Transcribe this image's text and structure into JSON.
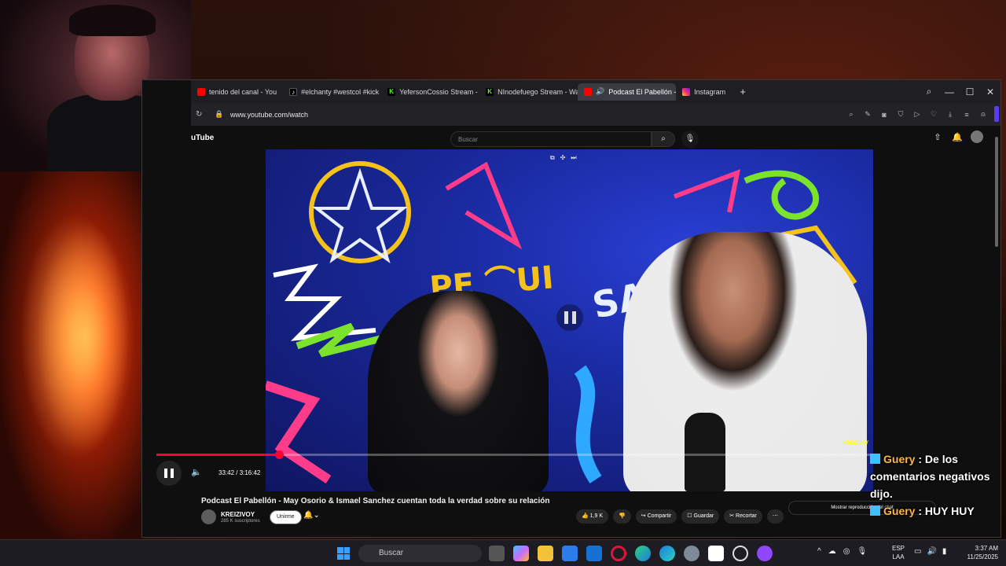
{
  "browser": {
    "tabs": [
      {
        "label": "tenido del canal - You",
        "icon": "youtube-icon",
        "active": false
      },
      {
        "label": "#elchanty #westcol #kick",
        "icon": "tiktok-icon",
        "active": false
      },
      {
        "label": "YefersonCossio Stream - V",
        "icon": "kick-icon",
        "active": false
      },
      {
        "label": "NInodefuego Stream - Wa",
        "icon": "kick-icon",
        "active": false
      },
      {
        "label": "Podcast El Pabellón - ",
        "icon": "youtube-icon",
        "active": true
      },
      {
        "label": "Instagram",
        "icon": "instagram-icon",
        "active": false
      }
    ],
    "url": "www.youtube.com/watch"
  },
  "youtube": {
    "logo": "uTube",
    "search_placeholder": "Buscar",
    "video_title": "Podcast El Pabellón - May Osorio & Ismael Sanchez cuentan toda la verdad sobre su relación",
    "channel_name": "KREIZIVOY",
    "channel_subs": "285 K suscriptores",
    "join_label": "Unirme",
    "likes": "1,9 K",
    "share_label": "Compartir",
    "save_label": "Guardar",
    "clip_label": "Recortar",
    "chat_replay_label": "Mostrar reproducción del chat",
    "watermark": "KREIZIVOY"
  },
  "player": {
    "time_display": "33:42 / 3:16:42",
    "progress_fraction": 0.1713,
    "state": "playing"
  },
  "stream_chat": [
    {
      "user": "Guery",
      "message": "De los comentarios negativos dijo."
    },
    {
      "user": "Guery",
      "message": "HUY HUY"
    }
  ],
  "taskbar": {
    "search_placeholder": "Buscar",
    "lang_line1": "ESP",
    "lang_line2": "LAA",
    "time": "3:37 AM",
    "date": "11/25/2025"
  },
  "colors": {
    "youtube_red": "#ff0033",
    "chat_username": "#ffb547",
    "windows_accent": "#3aa0ff"
  }
}
